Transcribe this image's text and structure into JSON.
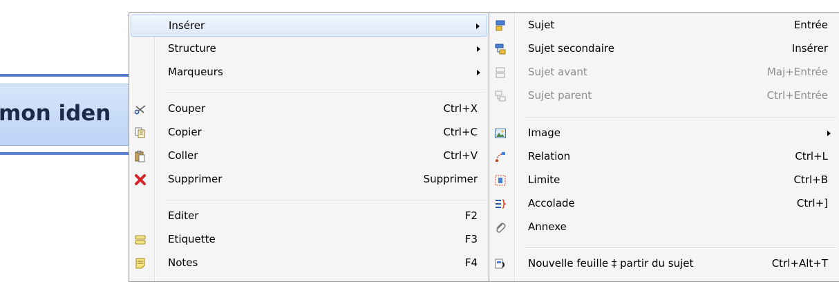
{
  "canvas": {
    "topic_text": "mon iden"
  },
  "main_menu": {
    "items": [
      {
        "label": "Insérer",
        "shortcut": "",
        "icon": "none",
        "submenu": true
      },
      {
        "label": "Structure",
        "shortcut": "",
        "icon": "none",
        "submenu": true
      },
      {
        "label": "Marqueurs",
        "shortcut": "",
        "icon": "none",
        "submenu": true
      },
      {
        "label": "Couper",
        "shortcut": "Ctrl+X",
        "icon": "scissors-icon"
      },
      {
        "label": "Copier",
        "shortcut": "Ctrl+C",
        "icon": "copy-icon"
      },
      {
        "label": "Coller",
        "shortcut": "Ctrl+V",
        "icon": "paste-icon"
      },
      {
        "label": "Supprimer",
        "shortcut": "Supprimer",
        "icon": "delete-x-icon"
      },
      {
        "label": "Editer",
        "shortcut": "F2",
        "icon": "none"
      },
      {
        "label": "Etiquette",
        "shortcut": "F3",
        "icon": "label-icon"
      },
      {
        "label": "Notes",
        "shortcut": "F4",
        "icon": "notes-icon"
      }
    ]
  },
  "sub_menu": {
    "items": [
      {
        "label": "Sujet",
        "shortcut": "Entrée",
        "icon": "topic-icon"
      },
      {
        "label": "Sujet secondaire",
        "shortcut": "Insérer",
        "icon": "subtopic-icon"
      },
      {
        "label": "Sujet avant",
        "shortcut": "Maj+Entrée",
        "icon": "topic-before-icon",
        "disabled": true
      },
      {
        "label": "Sujet parent",
        "shortcut": "Ctrl+Entrée",
        "icon": "parent-topic-icon",
        "disabled": true
      },
      {
        "label": "Image",
        "shortcut": "",
        "icon": "image-icon",
        "submenu": true
      },
      {
        "label": "Relation",
        "shortcut": "Ctrl+L",
        "icon": "relationship-icon"
      },
      {
        "label": "Limite",
        "shortcut": "Ctrl+B",
        "icon": "boundary-icon"
      },
      {
        "label": "Accolade",
        "shortcut": "Ctrl+]",
        "icon": "summary-brace-icon"
      },
      {
        "label": "Annexe",
        "shortcut": "",
        "icon": "paperclip-icon"
      },
      {
        "label": "Nouvelle feuille ‡ partir du sujet",
        "shortcut": "Ctrl+Alt+T",
        "icon": "new-sheet-icon"
      }
    ]
  },
  "colors": {
    "highlight_border": "#aecff7",
    "menu_background": "#f5f5f5",
    "disabled_text": "#8d8d8d",
    "topic_fill": "#bcd3f5"
  }
}
